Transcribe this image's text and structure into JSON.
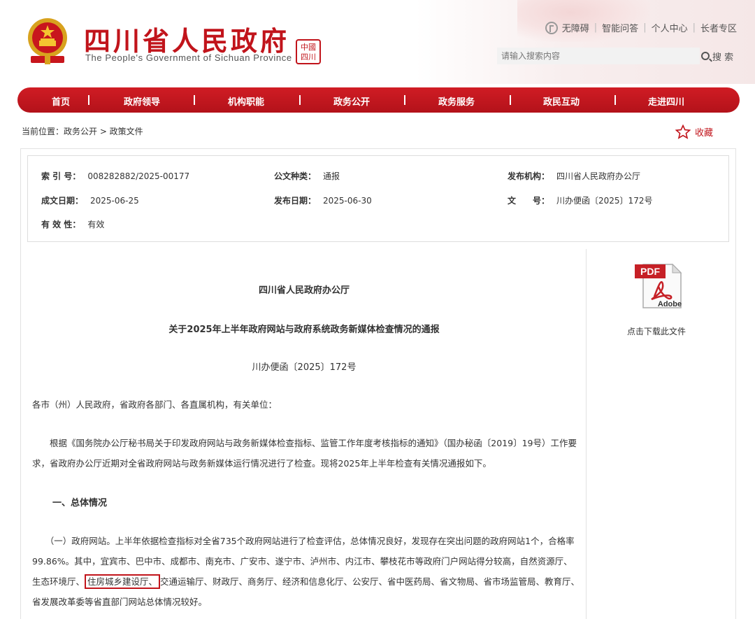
{
  "header": {
    "title": "四川省人民政府",
    "subtitle": "The People's Government of Sichuan Province",
    "seal_text": "中国四川",
    "top_links": [
      "无障碍",
      "智能问答",
      "个人中心",
      "长者专区"
    ],
    "search_placeholder": "请输入搜索内容",
    "search_button": "搜 索"
  },
  "nav": {
    "items": [
      "首页",
      "政府领导",
      "机构职能",
      "政务公开",
      "政务服务",
      "政民互动",
      "走进四川"
    ]
  },
  "breadcrumb": "当前位置：政务公开 > 政策文件",
  "favorite_label": "收藏",
  "meta": {
    "index_label": "索 引 号：",
    "index_value": "008282882/2025-00177",
    "doc_type_label": "公文种类：",
    "doc_type_value": "通报",
    "issuer_label": "发布机构：",
    "issuer_value": "四川省人民政府办公厅",
    "written_date_label": "成文日期：",
    "written_date_value": "2025-06-25",
    "publish_date_label": "发布日期：",
    "publish_date_value": "2025-06-30",
    "doc_no_label": "文　　号：",
    "doc_no_value": "川办便函〔2025〕172号",
    "validity_label": "有 效 性：",
    "validity_value": "有效"
  },
  "download": {
    "icon_label": "PDF",
    "brand": "Adobe",
    "text": "点击下载此文件"
  },
  "document": {
    "issuer": "四川省人民政府办公厅",
    "title": "关于2025年上半年政府网站与政府系统政务新媒体检查情况的通报",
    "number": "川办便函〔2025〕172号",
    "salutation": "各市（州）人民政府，省政府各部门、各直属机构，有关单位：",
    "para1": "　　根据《国务院办公厅秘书局关于印发政府网站与政务新媒体检查指标、监管工作年度考核指标的通知》（国办秘函〔2019〕19号）工作要求，省政府办公厅近期对全省政府网站与政务新媒体运行情况进行了检查。现将2025年上半年检查有关情况通报如下。",
    "section1": "一、总体情况",
    "para2_before": "　　（一）政府网站。上半年依据检查指标对全省735个政府网站进行了检查评估，总体情况良好，发现存在突出问题的政府网站1个，合格率99.86%。其中，宜宾市、巴中市、成都市、南充市、广安市、遂宁市、泸州市、内江市、攀枝花市等政府门户网站得分较高，自然资源厅、生态环境厅、",
    "para2_highlight": "住房城乡建设厅、",
    "para2_after": "交通运输厅、财政厅、商务厅、经济和信息化厅、公安厅、省中医药局、省文物局、省市场监管局、教育厅、省发展改革委等省直部门网站总体情况较好。"
  }
}
